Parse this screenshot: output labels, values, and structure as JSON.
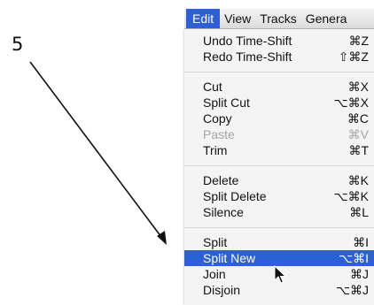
{
  "annotation": {
    "step_number": "5"
  },
  "menubar": {
    "items": [
      {
        "label": "Edit",
        "active": true
      },
      {
        "label": "View"
      },
      {
        "label": "Tracks"
      },
      {
        "label": "Genera"
      }
    ]
  },
  "menu": {
    "groups": [
      {
        "items": [
          {
            "label": "Undo Time-Shift",
            "shortcut": "⌘Z"
          },
          {
            "label": "Redo Time-Shift",
            "shortcut": "⇧⌘Z"
          }
        ]
      },
      {
        "items": [
          {
            "label": "Cut",
            "shortcut": "⌘X"
          },
          {
            "label": "Split Cut",
            "shortcut": "⌥⌘X"
          },
          {
            "label": "Copy",
            "shortcut": "⌘C"
          },
          {
            "label": "Paste",
            "shortcut": "⌘V",
            "disabled": true
          },
          {
            "label": "Trim",
            "shortcut": "⌘T"
          }
        ]
      },
      {
        "items": [
          {
            "label": "Delete",
            "shortcut": "⌘K"
          },
          {
            "label": "Split Delete",
            "shortcut": "⌥⌘K"
          },
          {
            "label": "Silence",
            "shortcut": "⌘L"
          }
        ]
      },
      {
        "items": [
          {
            "label": "Split",
            "shortcut": "⌘I"
          },
          {
            "label": "Split New",
            "shortcut": "⌥⌘I",
            "highlighted": true
          },
          {
            "label": "Join",
            "shortcut": "⌘J"
          },
          {
            "label": "Disjoin",
            "shortcut": "⌥⌘J"
          }
        ]
      }
    ]
  },
  "icons": {
    "cursor": "arrow-pointer-icon",
    "annotation_arrow": "diagonal-arrow-icon"
  },
  "colors": {
    "highlight": "#2d5fd6",
    "menu_bg": "#f4f4f4",
    "disabled_text": "#a5a5a5"
  }
}
